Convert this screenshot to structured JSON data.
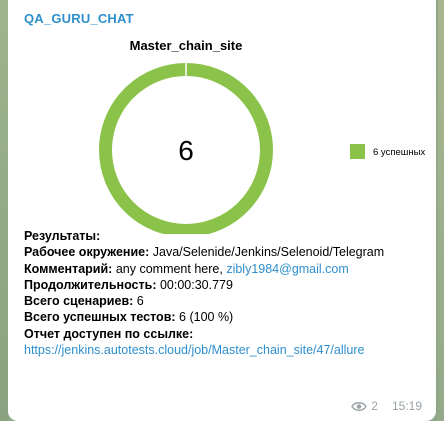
{
  "message": {
    "sender": "QA_GURU_CHAT",
    "views": "2",
    "time": "15:19"
  },
  "chart_data": {
    "type": "pie",
    "title": "Master_chain_site",
    "center_label": "6",
    "categories": [
      "6 успешных"
    ],
    "values": [
      6
    ],
    "colors": [
      "#8bc34a"
    ],
    "legend_position": "right"
  },
  "report": {
    "results_label": "Результаты:",
    "env_label": "Рабочее окружение:",
    "env_value": "Java/Selenide/Jenkins/Selenoid/Telegram",
    "comment_label": "Комментарий:",
    "comment_value": "any comment here,",
    "comment_email": "zibly1984@gmail.com",
    "duration_label": "Продолжительность:",
    "duration_value": "00:00:30.779",
    "scenarios_label": "Всего сценариев:",
    "scenarios_value": "6",
    "passed_label": "Всего успешных тестов:",
    "passed_value": "6 (100 %)",
    "link_label": "Отчет доступен по ссылке:",
    "link_url": "https://jenkins.autotests.cloud/job/Master_chain_site/47/allure"
  }
}
